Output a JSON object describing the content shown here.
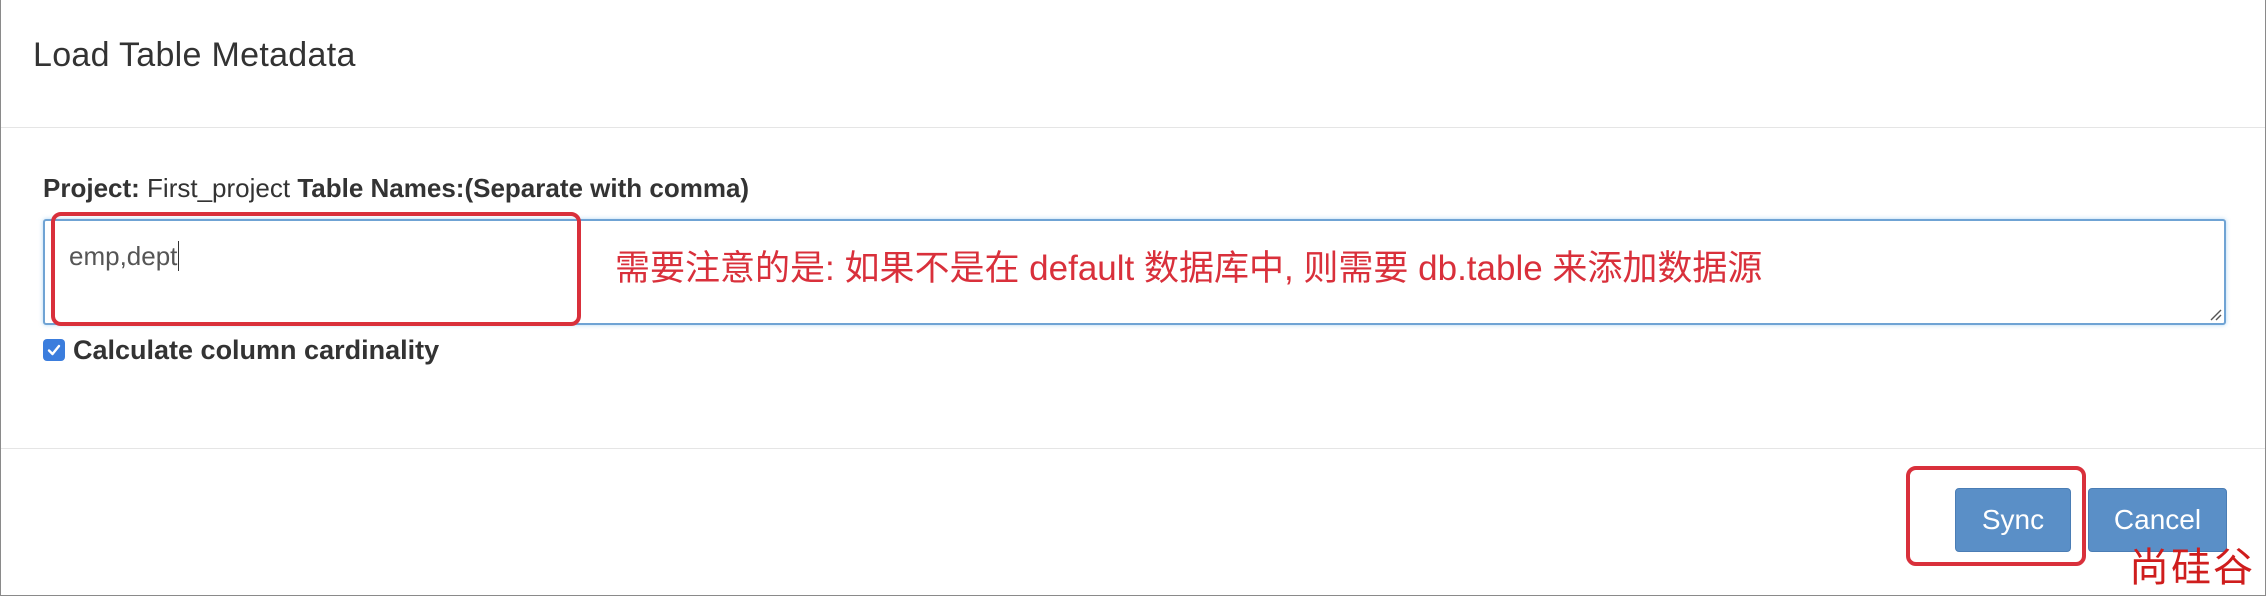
{
  "modal": {
    "title": "Load Table Metadata"
  },
  "form": {
    "project_label": "Project:",
    "project_value": "First_project",
    "table_names_label": "Table Names:(Separate with comma)",
    "table_names_value": "emp,dept",
    "cardinality_checked": true,
    "cardinality_label": "Calculate column cardinality"
  },
  "annotation": {
    "note": "需要注意的是: 如果不是在 default 数据库中, 则需要 db.table 来添加数据源",
    "color": "#d9303b"
  },
  "footer": {
    "sync_label": "Sync",
    "cancel_label": "Cancel"
  },
  "watermark": {
    "text": "尚硅谷"
  },
  "colors": {
    "primary_button": "#5a8fc7",
    "checkbox": "#3b7ddd",
    "focus_border": "#6fa3d4"
  }
}
